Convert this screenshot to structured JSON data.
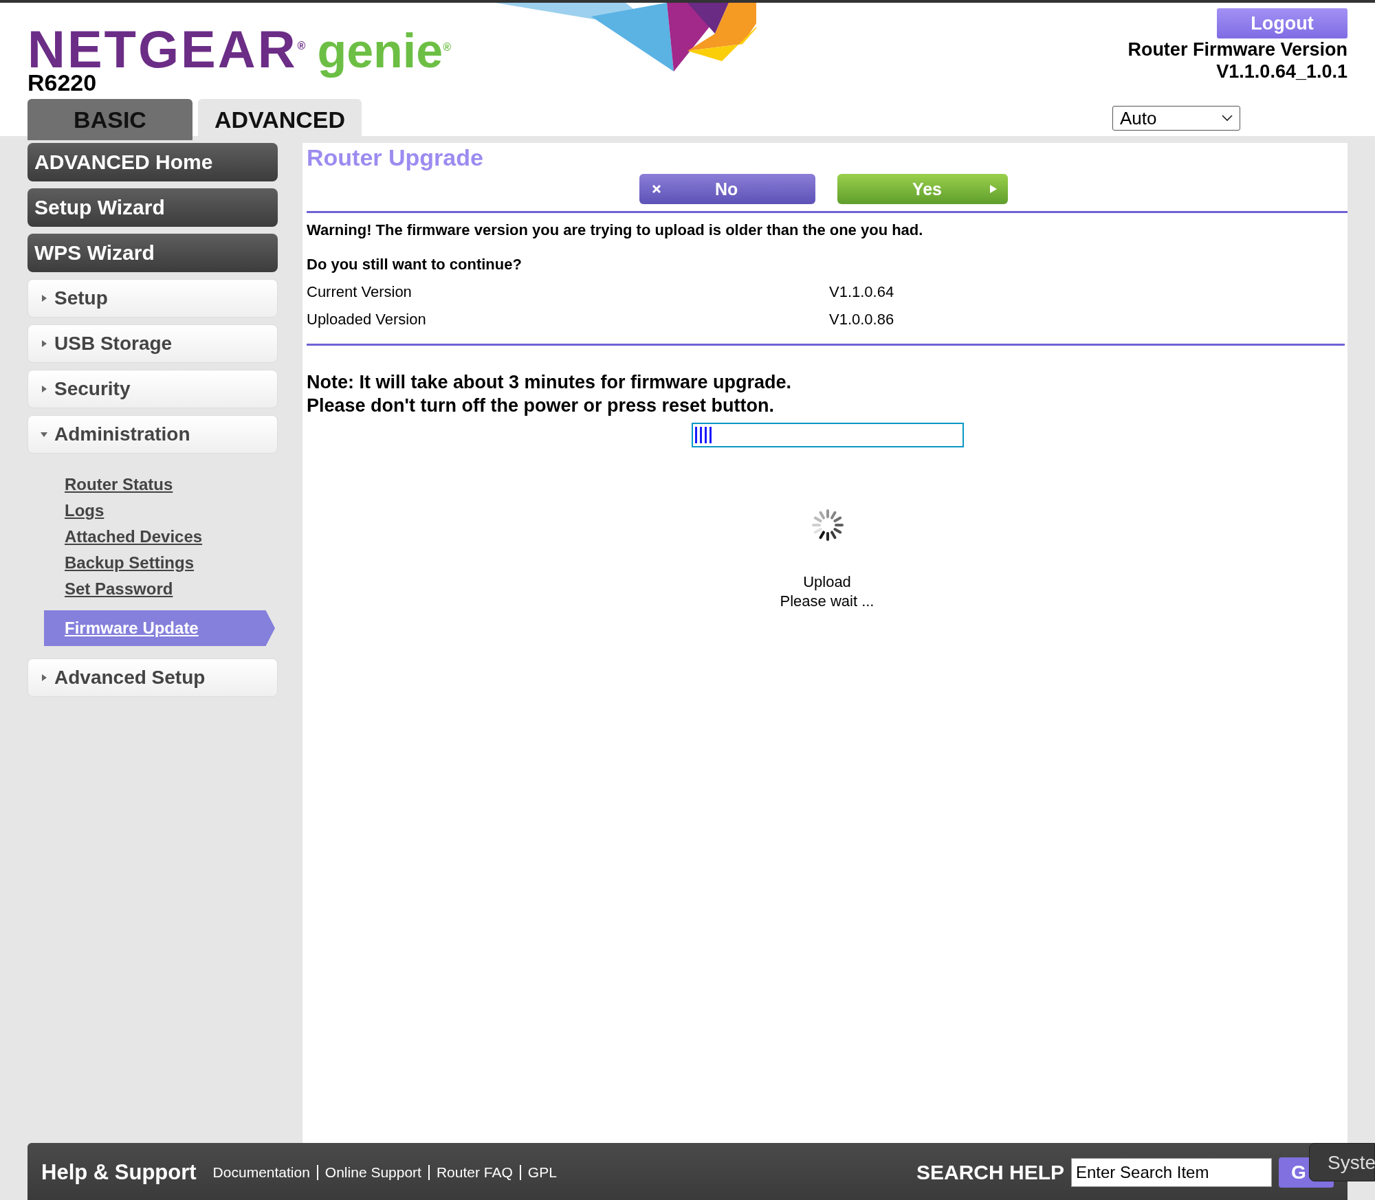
{
  "header": {
    "brand": "NETGEAR$^{®}$",
    "product": "genie$^{®}$",
    "model": "R6220",
    "logout": "Logout",
    "firmware_label": "Router Firmware Version",
    "firmware_version": "V1.1.0.64_1.0.1",
    "language": "Auto"
  },
  "tabs": [
    {
      "label": "BASIC",
      "selected": false
    },
    {
      "label": "ADVANCED",
      "selected": true
    }
  ],
  "sidebar": {
    "items": [
      {
        "label": "ADVANCED Home",
        "kind": "button"
      },
      {
        "label": "Setup Wizard",
        "kind": "button"
      },
      {
        "label": "WPS Wizard",
        "kind": "button"
      },
      {
        "label": "Setup",
        "kind": "section",
        "expanded": false
      },
      {
        "label": "USB Storage",
        "kind": "section",
        "expanded": false
      },
      {
        "label": "Security",
        "kind": "section",
        "expanded": false
      },
      {
        "label": "Administration",
        "kind": "section",
        "expanded": true,
        "children": [
          {
            "label": "Router Status",
            "selected": false
          },
          {
            "label": "Logs",
            "selected": false
          },
          {
            "label": "Attached Devices",
            "selected": false
          },
          {
            "label": "Backup Settings",
            "selected": false
          },
          {
            "label": "Set Password",
            "selected": false
          },
          {
            "label": "Firmware Update",
            "selected": true
          }
        ]
      },
      {
        "label": "Advanced Setup",
        "kind": "section",
        "expanded": false
      }
    ]
  },
  "main": {
    "title": "Router Upgrade",
    "buttons": [
      {
        "label": "No",
        "kind": "cancel"
      },
      {
        "label": "Yes",
        "kind": "confirm"
      }
    ],
    "warning": "Warning! The firmware version you are trying to upload is older than the one you had.",
    "question": "Do you still want to continue?",
    "versions": [
      {
        "label": "Current Version",
        "value": "V1.1.0.64"
      },
      {
        "label": "Uploaded Version",
        "value": "V1.0.0.86"
      }
    ],
    "note": [
      "Note: It will take about 3 minutes for firmware upgrade.",
      "Please don't turn off the power or press reset button."
    ],
    "progress": {
      "level": 0.07
    },
    "status": [
      "Upload",
      "Please wait ..."
    ]
  },
  "footer": {
    "title": "Help & Support",
    "links": [
      "Documentation",
      "Online Support",
      "Router FAQ",
      "GPL"
    ],
    "search_label": "SEARCH HELP",
    "search": {
      "placeholder": "Enter Search Item"
    },
    "go": "G",
    "tooltip": "Syste"
  }
}
